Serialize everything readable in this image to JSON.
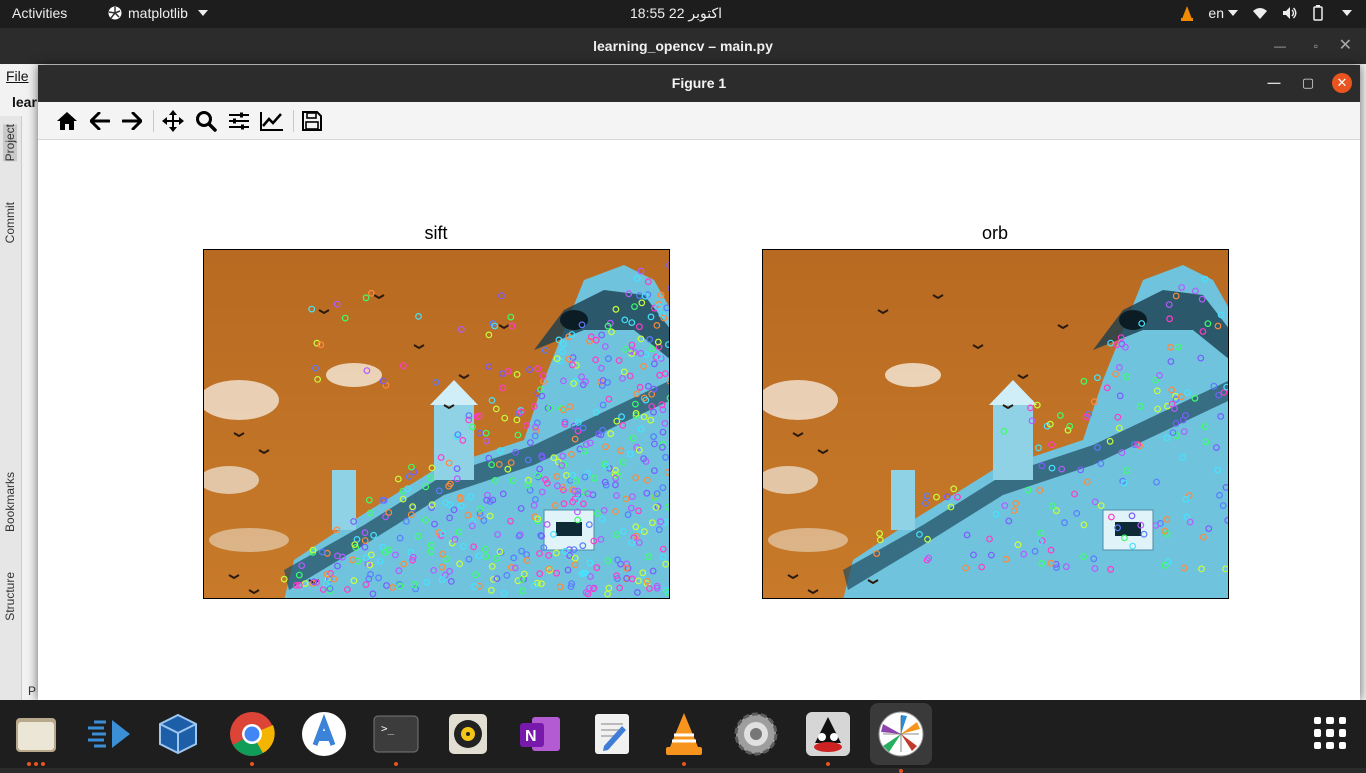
{
  "topbar": {
    "activities": "Activities",
    "app_name": "matplotlib",
    "clock": "18:55  22 اکتوبر",
    "lang": "en"
  },
  "ide": {
    "title": "learning_opencv – main.py",
    "menu_file": "File",
    "tab_name": "lear",
    "side_tabs": {
      "project": "Project",
      "commit": "Commit",
      "bookmarks": "Bookmarks",
      "structure": "Structure"
    },
    "bottom_text": "P"
  },
  "figure": {
    "title": "Figure 1",
    "toolbar": [
      "home-icon",
      "back-arrow-icon",
      "forward-arrow-icon",
      "pan-icon",
      "zoom-icon",
      "subplots-config-icon",
      "edit-curves-icon",
      "save-icon"
    ],
    "subplots": [
      {
        "title": "sift",
        "keypoints": "dense"
      },
      {
        "title": "orb",
        "keypoints": "moderate"
      }
    ],
    "colors": {
      "sky": "#c87a2a",
      "building": "#6fc3dd",
      "keypoint_ring": "#8a5cf0"
    }
  },
  "dock": {
    "apps": [
      "files-icon",
      "visual-studio-icon",
      "virtualbox-icon",
      "chrome-icon",
      "android-studio-icon",
      "terminal-icon",
      "rhythmbox-icon",
      "onenote-icon",
      "text-editor-icon",
      "vlc-icon",
      "settings-icon",
      "java-app-icon",
      "matplotlib-icon"
    ]
  }
}
